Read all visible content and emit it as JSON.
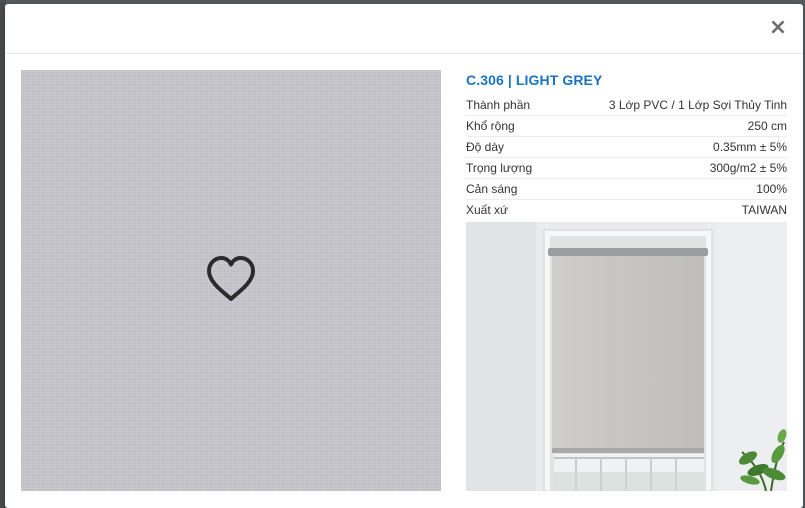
{
  "modal": {
    "close_label": "×"
  },
  "product": {
    "title": "C.306 | LIGHT GREY",
    "specs": [
      {
        "label": "Thành phần",
        "value": "3 Lớp PVC / 1 Lớp Sợi Thủy Tinh"
      },
      {
        "label": "Khổ rộng",
        "value": "250 cm"
      },
      {
        "label": "Độ dày",
        "value": "0.35mm ± 5%"
      },
      {
        "label": "Trọng lượng",
        "value": "300g/m2 ± 5%"
      },
      {
        "label": "Cản sáng",
        "value": "100%"
      },
      {
        "label": "Xuất xứ",
        "value": "TAIWAN"
      }
    ]
  },
  "icons": {
    "favorite": "heart-outline-icon",
    "close": "close-icon"
  },
  "colors": {
    "title_accent": "#1a74c2",
    "swatch": "#c5c4ca",
    "text": "#333333"
  }
}
